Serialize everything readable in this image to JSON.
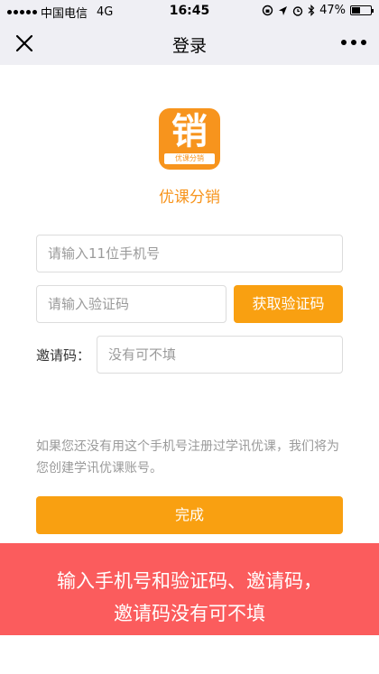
{
  "status_bar": {
    "carrier": "中国电信",
    "network": "4G",
    "time": "16:45",
    "battery": "47%",
    "battery_level": 0.47
  },
  "nav": {
    "title": "登录"
  },
  "logo": {
    "char": "销",
    "band_text": "优课分销",
    "color": "#f7941d"
  },
  "app": {
    "name": "优课分销"
  },
  "form": {
    "phone_placeholder": "请输入11位手机号",
    "code_placeholder": "请输入验证码",
    "get_code_label": "获取验证码",
    "invite_label": "邀请码：",
    "invite_placeholder": "没有可不填"
  },
  "notice": {
    "text": "如果您还没有用这个手机号注册过学讯优课，我们将为您创建学讯优课账号。"
  },
  "done_button": {
    "label": "完成"
  },
  "banner": {
    "line1": "输入手机号和验证码、邀请码，",
    "line2": "邀请码没有可不填"
  },
  "colors": {
    "accent": "#f9a011",
    "banner": "#fb5c5d"
  }
}
